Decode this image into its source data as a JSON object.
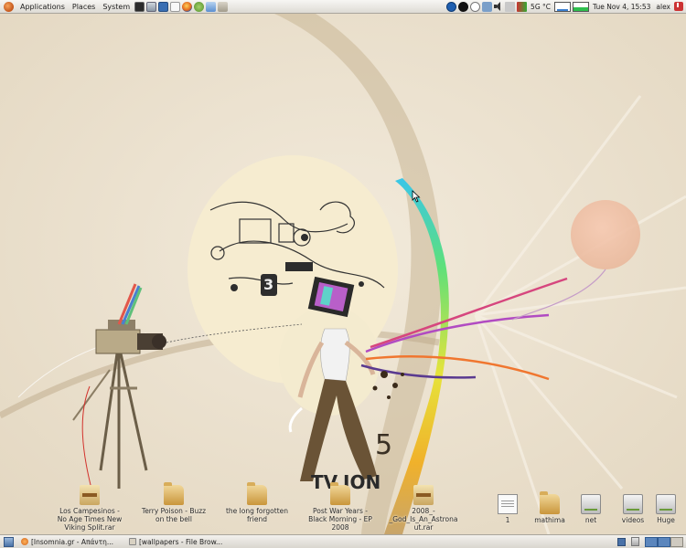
{
  "top_panel": {
    "menus": [
      "Applications",
      "Places",
      "System"
    ],
    "temperature": "5G °C",
    "clock": "Tue Nov  4, 15:53",
    "user": "alex"
  },
  "desktop_icons": [
    {
      "label": "Los Campesinos - No Age Times New Viking Split.rar",
      "type": "rar"
    },
    {
      "label": "Terry Poison - Buzz on the bell",
      "type": "folder"
    },
    {
      "label": "the long forgotten friend",
      "type": "folder"
    },
    {
      "label": "Post War Years - Black Morning - EP 2008",
      "type": "folder"
    },
    {
      "label": "2008_-_God_Is_An_Astronaut.rar",
      "type": "rar"
    },
    {
      "label": "1",
      "type": "file"
    },
    {
      "label": "mathima",
      "type": "folder"
    },
    {
      "label": "net",
      "type": "drive"
    },
    {
      "label": "videos",
      "type": "drive"
    },
    {
      "label": "Huge",
      "type": "drive"
    }
  ],
  "taskbar": {
    "tasks": [
      {
        "label": "[Insomnia.gr - Απάντη..."
      },
      {
        "label": "[wallpapers - File Brow..."
      }
    ]
  },
  "colors": {
    "panel": "#e9e6e0",
    "wallpaper": "#eee5d6",
    "active_workspace": "#5b86bd"
  }
}
